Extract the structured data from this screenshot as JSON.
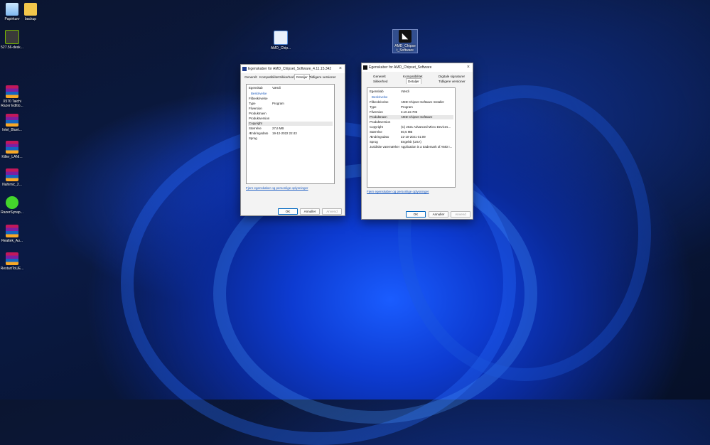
{
  "desktop": {
    "icons": [
      {
        "label": "Papirkurv",
        "icon": "recycle-bin-icon"
      },
      {
        "label": "backup",
        "icon": "folder-icon"
      },
      {
        "label": "527.56-desk...",
        "icon": "nvidia-installer-icon"
      },
      {
        "label": "X570 Taichi Razer Editio...",
        "icon": "winrar-archive-icon"
      },
      {
        "label": "Intel_Bluet...",
        "icon": "winrar-archive-icon"
      },
      {
        "label": "Killer_LANI...",
        "icon": "winrar-archive-icon"
      },
      {
        "label": "Nahimic_2...",
        "icon": "winrar-archive-icon"
      },
      {
        "label": "RazerSynap...",
        "icon": "razer-synapse-icon"
      },
      {
        "label": "Realtek_Au...",
        "icon": "winrar-archive-icon"
      },
      {
        "label": "RestartToUE...",
        "icon": "winrar-archive-icon"
      },
      {
        "label": "AMD_Chip...",
        "icon": "installer-file-icon"
      },
      {
        "label": "AMD_Chipse t_Software",
        "icon": "amd-logo-icon"
      }
    ]
  },
  "dialog_left": {
    "title": "Egenskaber for AMD_Chipset_Software_4.11.15.342",
    "tabs": [
      "Generelt",
      "Kompatibilitet",
      "Sikkerhed",
      "Detaljer",
      "Tidligere versioner"
    ],
    "active_tab": "Detaljer",
    "columns": {
      "key": "Egenskab",
      "value": "Værdi"
    },
    "section": "Beskrivelse",
    "rows": [
      {
        "k": "Filbeskrivelse",
        "v": ""
      },
      {
        "k": "Type",
        "v": "Program"
      },
      {
        "k": "Filversion",
        "v": ""
      },
      {
        "k": "Produktnavn",
        "v": ""
      },
      {
        "k": "Produktversion",
        "v": ""
      },
      {
        "k": "Copyright",
        "v": ""
      },
      {
        "k": "Størrelse",
        "v": "27,6 MB"
      },
      {
        "k": "Ændringsdato",
        "v": "19-12-2022 22:43"
      },
      {
        "k": "Sprog",
        "v": ""
      }
    ],
    "link": "Fjern egenskaber og personlige oplysninger",
    "buttons": {
      "ok": "OK",
      "cancel": "Annuller",
      "apply": "Anvend"
    }
  },
  "dialog_right": {
    "title": "Egenskaber for AMD_Chipset_Software",
    "tabs_row1": [
      "Generelt",
      "Kompatibilitet",
      "Digitale signaturer"
    ],
    "tabs_row2": [
      "Sikkerhed",
      "Detaljer",
      "Tidligere versioner"
    ],
    "active_tab": "Detaljer",
    "columns": {
      "key": "Egenskab",
      "value": "Værdi"
    },
    "section": "Beskrivelse",
    "rows": [
      {
        "k": "Filbeskrivelse",
        "v": "AMD Chipset Software Installer"
      },
      {
        "k": "Type",
        "v": "Program"
      },
      {
        "k": "Filversion",
        "v": "3.10.22.706"
      },
      {
        "k": "Produktnavn",
        "v": "AMD Chipset Software"
      },
      {
        "k": "Produktversion",
        "v": ""
      },
      {
        "k": "Copyright",
        "v": "(C) 2021 Advanced Micro Devices..."
      },
      {
        "k": "Størrelse",
        "v": "50,5 MB"
      },
      {
        "k": "Ændringsdato",
        "v": "22-10-2021 01:09"
      },
      {
        "k": "Sprog",
        "v": "Engelsk (USA)"
      },
      {
        "k": "Juridiske varemærker",
        "v": "Application is a trademark of AMD I..."
      }
    ],
    "link": "Fjern egenskaber og personlige oplysninger",
    "buttons": {
      "ok": "OK",
      "cancel": "Annuller",
      "apply": "Anvend"
    }
  }
}
